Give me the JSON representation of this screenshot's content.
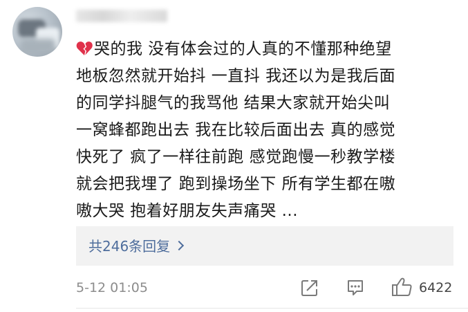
{
  "comment": {
    "lines": [
      "哭的我 没有体会过的人真的不懂那种绝望",
      "地板忽然就开始抖 一直抖 我还以为是我后面",
      "的同学抖腿气的我骂他 结果大家就开始尖叫",
      "一窝蜂都跑出去 我在比较后面出去 真的感觉",
      "快死了 疯了一样往前跑 感觉跑慢一秒教学楼",
      "就会把我埋了 跑到操场坐下 所有学生都在嗷",
      "嗷大哭 抱着好朋友失声痛哭 ..."
    ],
    "emoji_icon": "broken-heart-icon"
  },
  "replies": {
    "label": "共246条回复"
  },
  "meta": {
    "timestamp": "5-12 01:05",
    "like_count": "6422"
  },
  "colors": {
    "link": "#4e6d9c",
    "heart": "#e0314b",
    "text": "#1a1a1a",
    "muted": "#8c8c8c"
  }
}
